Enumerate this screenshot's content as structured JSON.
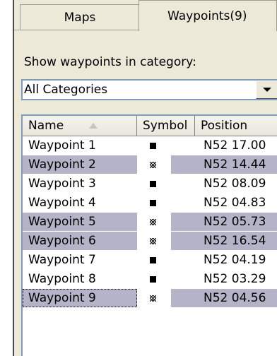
{
  "tabs": {
    "maps": "Maps",
    "waypoints": "Waypoints(9)"
  },
  "category": {
    "label": "Show waypoints in category:",
    "selected": "All Categories"
  },
  "table": {
    "headers": {
      "name": "Name",
      "symbol": "Symbol",
      "position": "Position"
    },
    "rows": [
      {
        "name": "Waypoint 1",
        "position": "N52 17.00",
        "selected": false,
        "symbol": "filled-square"
      },
      {
        "name": "Waypoint 2",
        "position": "N52 14.44",
        "selected": true,
        "symbol": "hatched-square"
      },
      {
        "name": "Waypoint 3",
        "position": "N52 08.09",
        "selected": false,
        "symbol": "filled-square"
      },
      {
        "name": "Waypoint 4",
        "position": "N52 04.83",
        "selected": false,
        "symbol": "filled-square"
      },
      {
        "name": "Waypoint 5",
        "position": "N52 05.73",
        "selected": true,
        "symbol": "hatched-square"
      },
      {
        "name": "Waypoint 6",
        "position": "N52 16.54",
        "selected": true,
        "symbol": "hatched-square"
      },
      {
        "name": "Waypoint 7",
        "position": "N52 04.19",
        "selected": false,
        "symbol": "filled-square"
      },
      {
        "name": "Waypoint 8",
        "position": "N52 03.29",
        "selected": false,
        "symbol": "filled-square"
      },
      {
        "name": "Waypoint 9",
        "position": "N52 04.56",
        "selected": true,
        "symbol": "hatched-square"
      }
    ]
  },
  "colors": {
    "selection": "#b4b3c8",
    "panel": "#ece9d8",
    "border": "#7f9db9"
  }
}
